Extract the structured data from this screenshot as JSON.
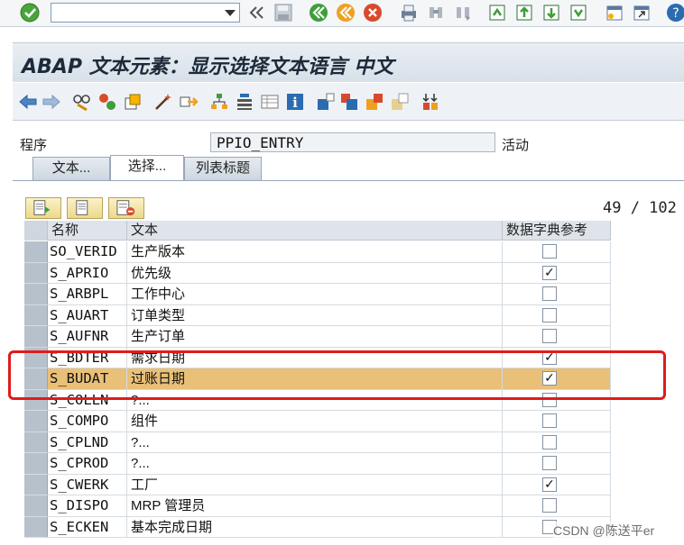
{
  "window": {
    "title": "ABAP 文本元素：显示选择文本语言 中文"
  },
  "system_toolbar": {
    "command_field_value": "",
    "icons": [
      "enter-check-icon",
      "back-icon",
      "save-icon",
      "green-back-icon",
      "exit-icon",
      "cancel-icon",
      "print-icon",
      "find-icon",
      "find-next-icon",
      "first-page-icon",
      "prev-page-icon",
      "next-page-icon",
      "last-page-icon",
      "new-session-icon",
      "shortcut-icon",
      "help-icon"
    ]
  },
  "app_toolbar": {
    "icons": [
      "prev-object-icon",
      "next-object-icon",
      "display-change-icon",
      "active-inactive-icon",
      "other-object-icon",
      "magic-wand-icon",
      "where-used-icon",
      "hierarchy-icon",
      "outline-icon",
      "table-view-icon",
      "info-icon",
      "insert-icon",
      "copy-icon",
      "compare-icon",
      "move-icon",
      "sort-icon"
    ]
  },
  "program": {
    "label": "程序",
    "value": "PPIO_ENTRY",
    "status": "活动"
  },
  "tabs": [
    {
      "label": "文本..."
    },
    {
      "label": "选择..."
    },
    {
      "label": "列表标题"
    }
  ],
  "panel": {
    "counter": "49 / 102",
    "columns": {
      "name": "名称",
      "text": "文本",
      "dict_ref": "数据字典参考"
    }
  },
  "rows": [
    {
      "name": "SO_VERID",
      "text": "生产版本",
      "dict_ref": ""
    },
    {
      "name": "S_APRIO",
      "text": "优先级",
      "dict_ref": "✓"
    },
    {
      "name": "S_ARBPL",
      "text": "工作中心",
      "dict_ref": ""
    },
    {
      "name": "S_AUART",
      "text": "订单类型",
      "dict_ref": ""
    },
    {
      "name": "S_AUFNR",
      "text": "生产订单",
      "dict_ref": ""
    },
    {
      "name": "S_BDTER",
      "text": "需求日期",
      "dict_ref": "✓"
    },
    {
      "name": "S_BUDAT",
      "text": "过账日期",
      "dict_ref": "✓"
    },
    {
      "name": "S_COLLN",
      "text": "?...",
      "dict_ref": ""
    },
    {
      "name": "S_COMPO",
      "text": "组件",
      "dict_ref": ""
    },
    {
      "name": "S_CPLND",
      "text": "?...",
      "dict_ref": ""
    },
    {
      "name": "S_CPROD",
      "text": "?...",
      "dict_ref": ""
    },
    {
      "name": "S_CWERK",
      "text": "工厂",
      "dict_ref": "✓"
    },
    {
      "name": "S_DISPO",
      "text": "MRP 管理员",
      "dict_ref": ""
    },
    {
      "name": "S_ECKEN",
      "text": "基本完成日期",
      "dict_ref": ""
    }
  ],
  "watermark": "CSDN @陈送平er"
}
